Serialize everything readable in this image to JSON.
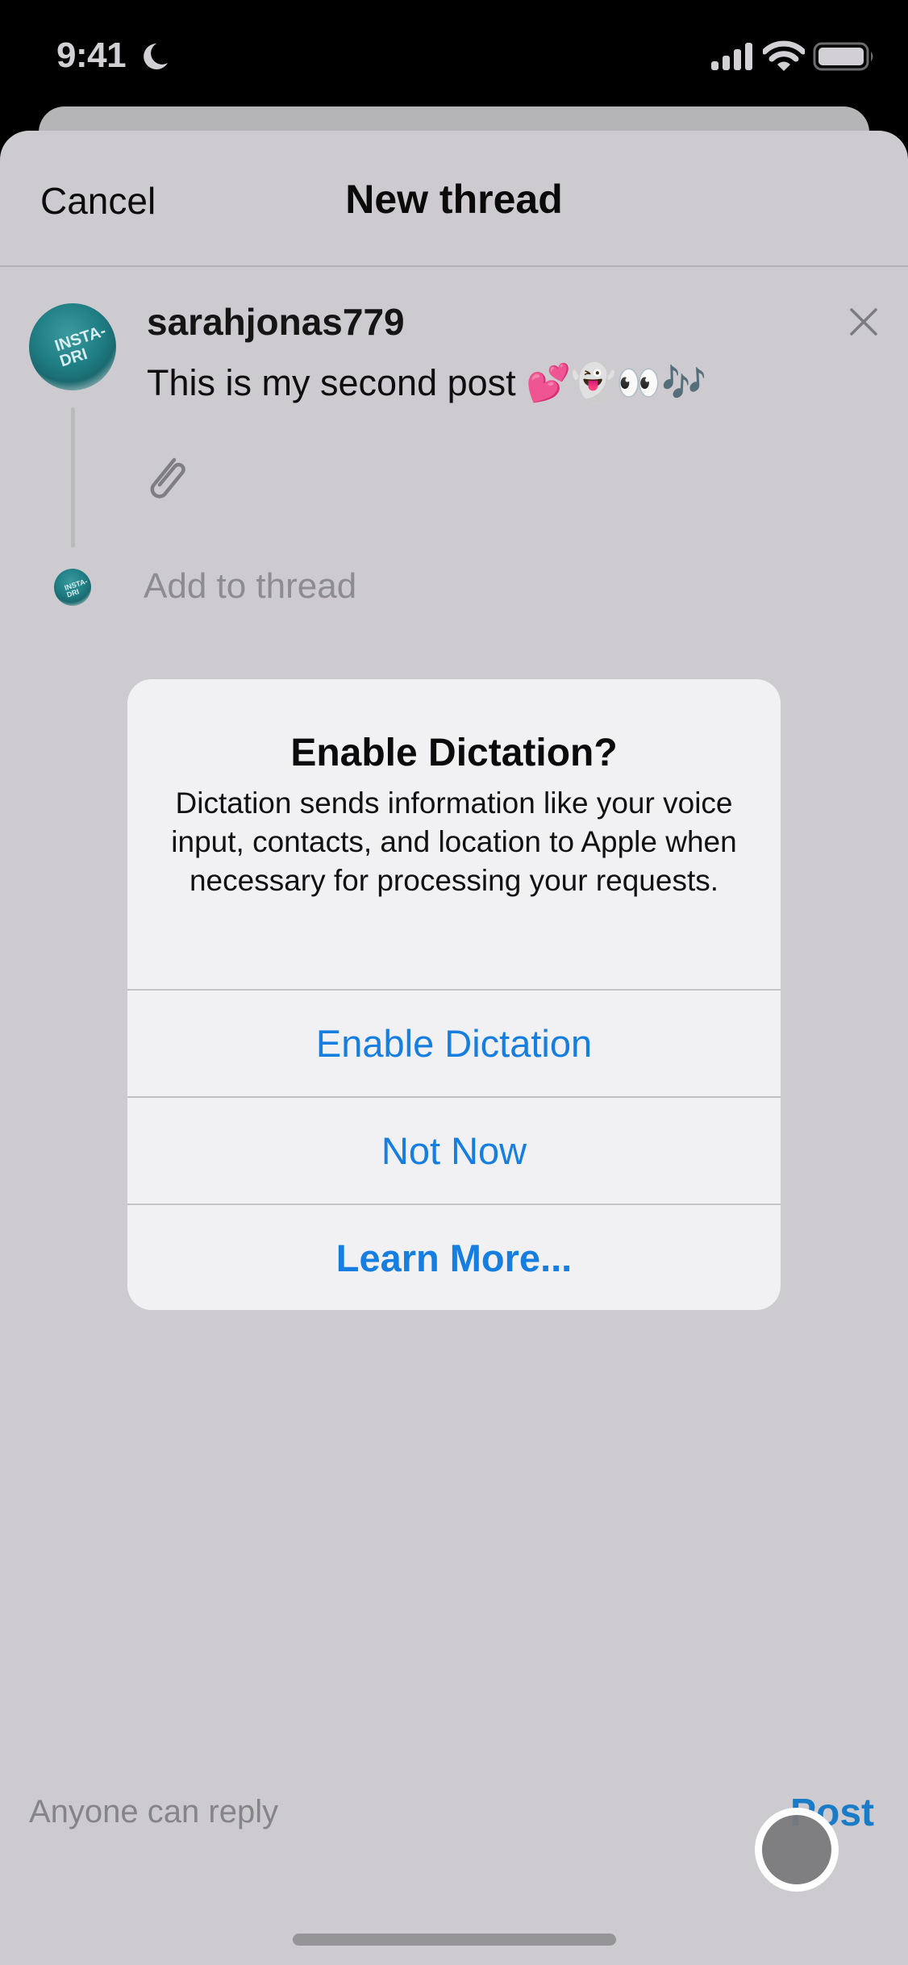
{
  "status_bar": {
    "time": "9:41",
    "focus_icon": "moon-icon",
    "signal_icon": "cellular-signal-icon",
    "wifi_icon": "wifi-icon",
    "battery_icon": "battery-icon"
  },
  "header": {
    "cancel_label": "Cancel",
    "title": "New thread"
  },
  "composer": {
    "username": "sarahjonas779",
    "avatar_text": "INSTA-DRI",
    "post_text": "This is my second post 💕👻👀🎶",
    "close_icon": "close-icon",
    "attach_icon": "paperclip-icon",
    "add_to_thread_placeholder": "Add to thread"
  },
  "dialog": {
    "title": "Enable Dictation?",
    "message": "Dictation sends information like your voice input, contacts, and location to Apple when necessary for processing your requests.",
    "buttons": [
      {
        "label": "Enable Dictation",
        "bold": false
      },
      {
        "label": "Not Now",
        "bold": false
      },
      {
        "label": "Learn More...",
        "bold": true
      }
    ]
  },
  "footer": {
    "reply_setting": "Anyone can reply",
    "post_label": "Post"
  },
  "colors": {
    "accent": "#157ee0",
    "post_accent": "#1a7bc7",
    "sheet_background": "#cdcbcf",
    "dialog_background": "#f1f0f3"
  }
}
